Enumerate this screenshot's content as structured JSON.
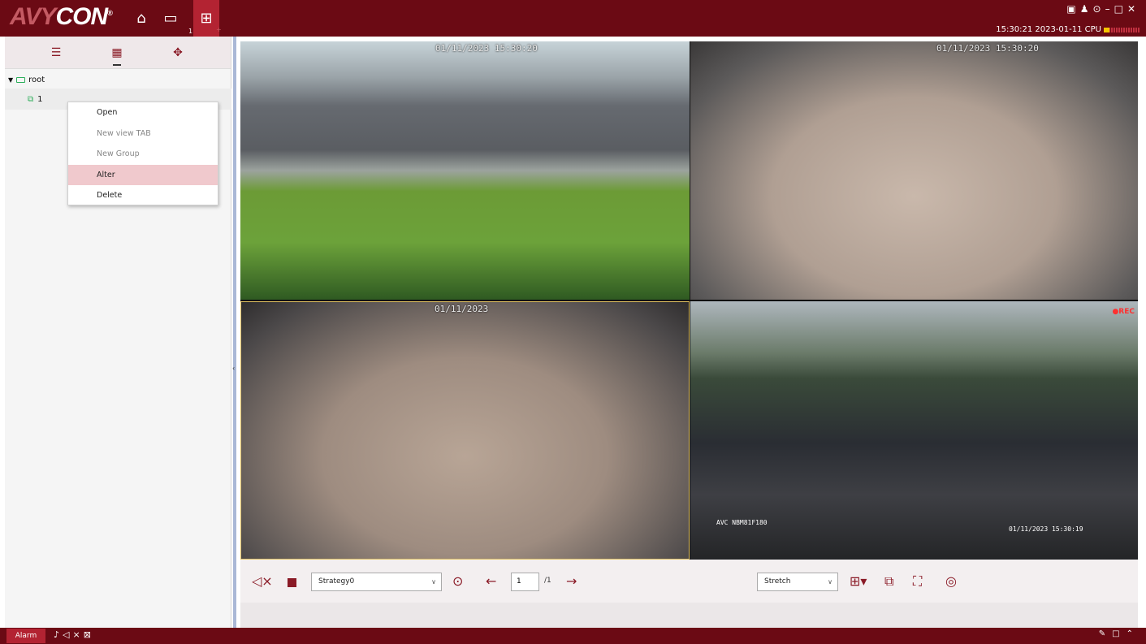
{
  "app": {
    "logo_prefix": "AVY",
    "logo_suffix": "CON",
    "registered": "®",
    "tab_number": "1",
    "status": {
      "time": "15:30:21 2023-01-11 CPU",
      "cpu_level_fraction": 0.15
    }
  },
  "titlebar": {
    "home_icon": "home-icon",
    "keyboard_icon": "keyboard-icon",
    "grid_icon": "grid-icon",
    "win_icons": [
      "image-icon",
      "user-icon",
      "settings-icon",
      "minimize-icon",
      "maximize-icon",
      "close-icon"
    ]
  },
  "sidebar": {
    "tabs": [
      "list-icon",
      "grid-icon",
      "ptz-icon"
    ],
    "tree": {
      "root_label": "root",
      "child_label": "1"
    }
  },
  "context_menu": {
    "items": [
      {
        "label": "Open",
        "enabled": true
      },
      {
        "label": "New view TAB",
        "enabled": false
      },
      {
        "label": "New Group",
        "enabled": false
      },
      {
        "label": "Alter",
        "enabled": true,
        "highlighted": true
      },
      {
        "label": "Delete",
        "enabled": true
      }
    ]
  },
  "video": {
    "tiles": [
      {
        "timestamp": "01/11/2023 15:30:20"
      },
      {
        "timestamp": "01/11/2023 15:30:20"
      },
      {
        "timestamp": "01/11/2023"
      },
      {
        "label": "AVC NBM81F180",
        "timestamp": "01/11/2023 15:30:19",
        "rec": "●REC"
      }
    ]
  },
  "toolbar": {
    "strategy": "Strategy0",
    "page_current": "1",
    "page_total": "/1",
    "stretch": "Stretch",
    "left_icons": [
      "mute-icon",
      "stop-icon",
      "play-circle-icon",
      "arrow-left-icon",
      "arrow-right-icon"
    ],
    "right_icons": [
      "layout-grid-icon",
      "copy-icon",
      "fullscreen-icon",
      "snapshot-icon"
    ]
  },
  "footer": {
    "alarm_label": "Alarm",
    "icons": [
      "bell-off-icon",
      "mute-icon",
      "window-close-icon"
    ],
    "right_icons": [
      "pin-icon",
      "window-icon",
      "collapse-up-icon"
    ]
  }
}
